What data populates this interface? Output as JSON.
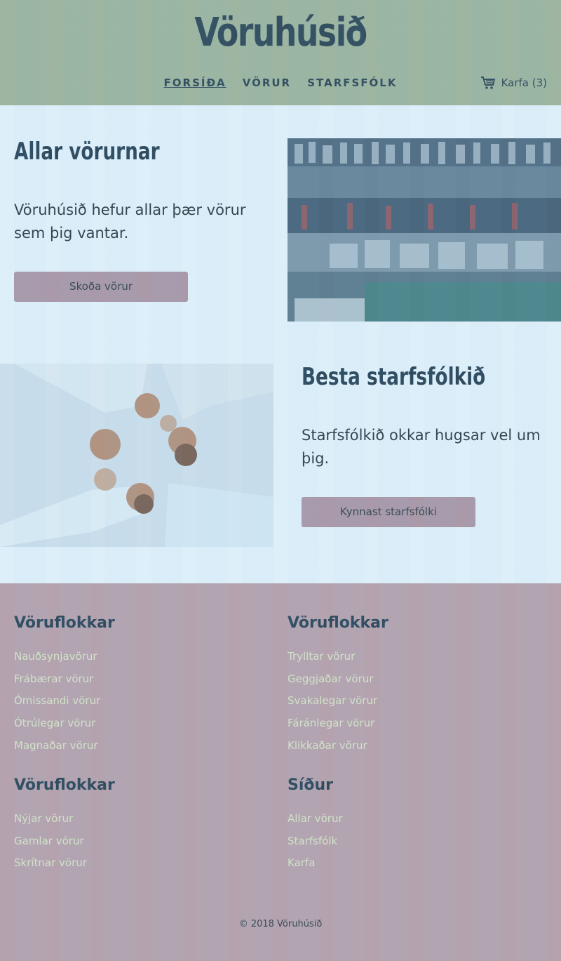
{
  "header": {
    "site_title": "Vöruhúsið",
    "nav": [
      {
        "label": "FORSÍÐA",
        "active": true
      },
      {
        "label": "VÖRUR",
        "active": false
      },
      {
        "label": "STARFSFÓLK",
        "active": false
      }
    ],
    "cart_label": "Karfa (3)",
    "cart_icon": "cart-icon",
    "background": "#a9b28a"
  },
  "main": {
    "feature1": {
      "title": "Allar vörurnar",
      "text": "Vöruhúsið hefur allar þær vörur sem þig vantar.",
      "button": "Skoða vörur",
      "image": "store-shelves-photo"
    },
    "feature2": {
      "title": "Besta starfsfólkið",
      "text": "Starfsfólkið okkar hugsar vel um þig.",
      "button": "Kynnast starfsfólki",
      "image": "joined-hands-photo"
    },
    "button_color": "#b98d95"
  },
  "footer": {
    "columns": [
      {
        "title": "Vöruflokkar",
        "links": [
          "Nauðsynjavörur",
          "Frábærar vörur",
          "Ómissandi vörur",
          "Ótrúlegar vörur",
          "Magnaðar vörur"
        ]
      },
      {
        "title": "Vöruflokkar",
        "links": [
          "Trylltar vörur",
          "Geggjaðar vörur",
          "Svakalegar vörur",
          "Fáránlegar vörur",
          "Klikkaðar vörur"
        ]
      },
      {
        "title": "Vöruflokkar",
        "links": [
          "Nýjar vörur",
          "Gamlar vörur",
          "Skrítnar vörur"
        ]
      },
      {
        "title": "Síður",
        "links": [
          "Allar vörur",
          "Starfsfólk",
          "Karfa"
        ]
      }
    ],
    "copyright": "© 2018 Vöruhúsið",
    "background": "#c89a9b",
    "link_color": "#f2efc0"
  }
}
